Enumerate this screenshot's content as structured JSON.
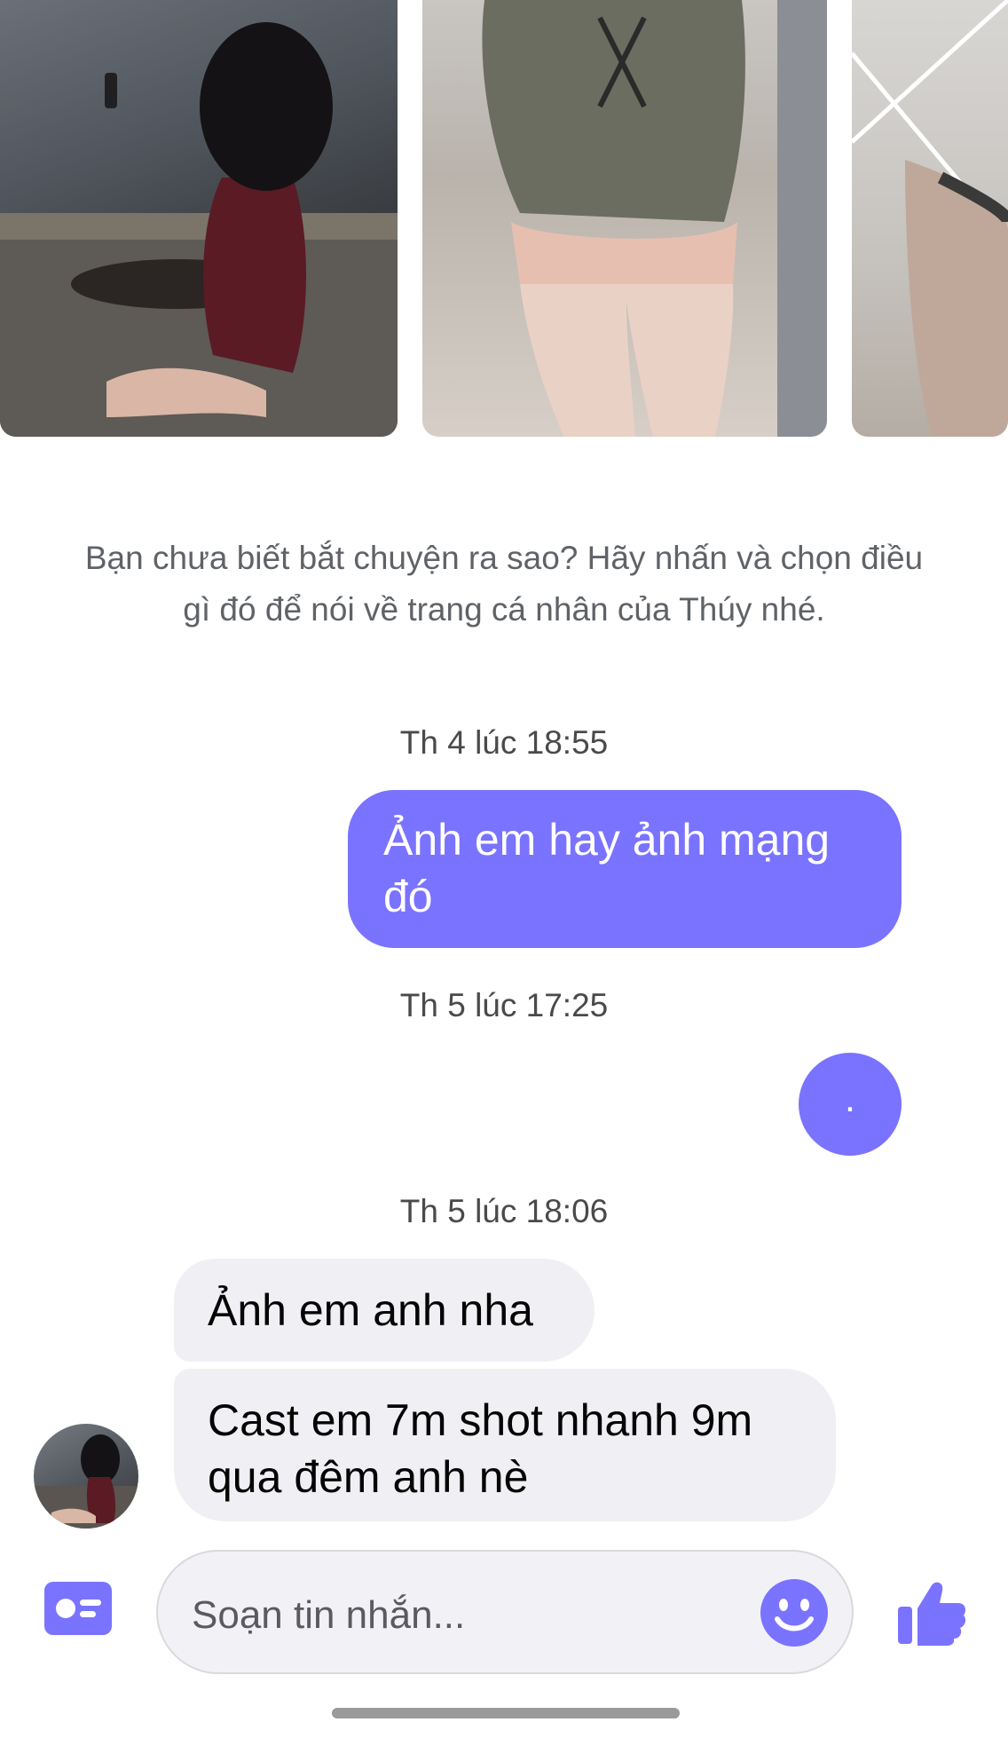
{
  "photos": [
    {
      "name": "photo-1"
    },
    {
      "name": "photo-2"
    },
    {
      "name": "photo-3"
    }
  ],
  "hint_text": "Bạn chưa biết bắt chuyện ra sao? Hãy nhấn và chọn điều gì đó để nói về trang cá nhân của Thúy nhé.",
  "messages": [
    {
      "timestamp": "Th 4 lúc 18:55",
      "direction": "outgoing",
      "text": "Ảnh em hay ảnh mạng đó"
    },
    {
      "timestamp": "Th 5 lúc 17:25",
      "direction": "outgoing",
      "text": "."
    },
    {
      "timestamp": "Th 5 lúc 18:06",
      "direction": "incoming",
      "text": "Ảnh em anh nha"
    },
    {
      "timestamp": "",
      "direction": "incoming",
      "text": "Cast em 7m shot nhanh 9m qua đêm anh nè"
    }
  ],
  "composer": {
    "placeholder": "Soạn tin nhắn...",
    "left_icon": "profile-card-icon",
    "emoji_icon": "smiley-icon",
    "send_icon": "thumbs-up-icon"
  },
  "colors": {
    "accent": "#7a73ff",
    "incoming_bubble": "#f0f0f4",
    "hint_text": "#5f6368"
  }
}
